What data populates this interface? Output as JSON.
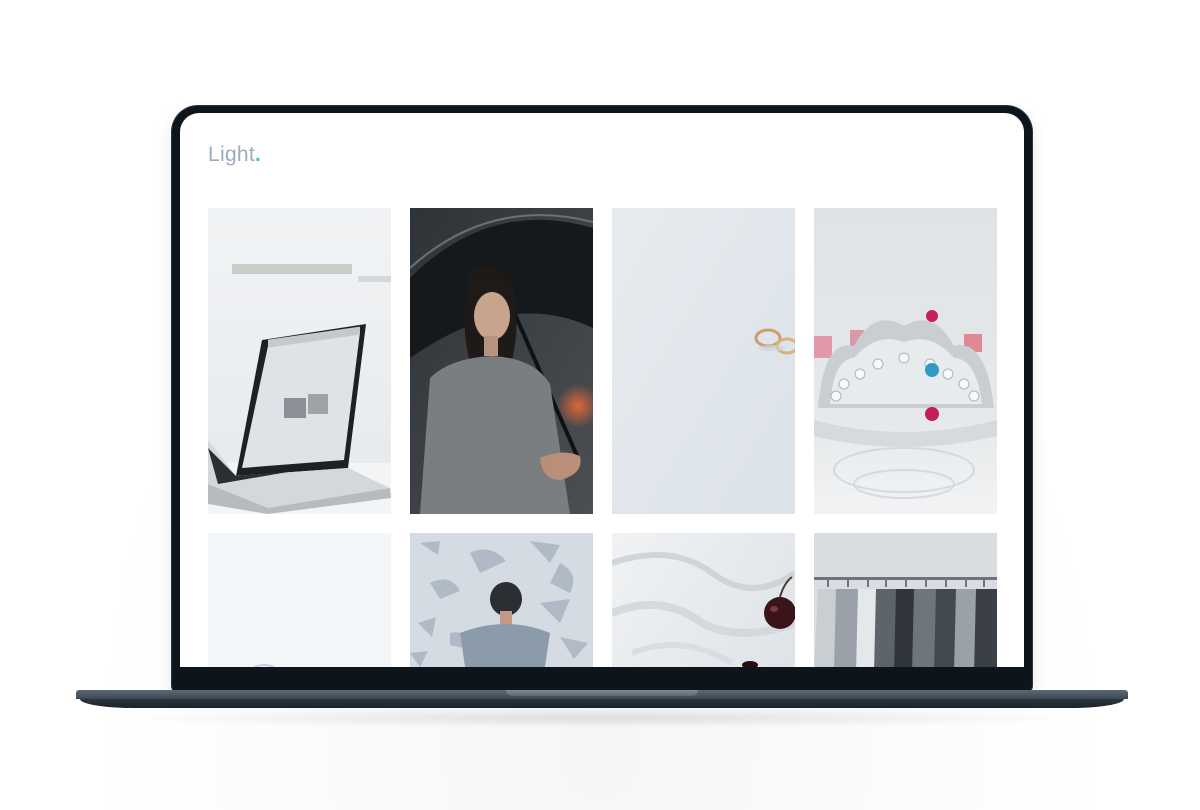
{
  "site": {
    "logo_text": "Light",
    "logo_dot": "."
  },
  "gallery": {
    "items": [
      {
        "subject": "laptop-on-desk"
      },
      {
        "subject": "woman-with-umbrella"
      },
      {
        "subject": "gold-rings"
      },
      {
        "subject": "jeweled-tiara"
      },
      {
        "subject": "white-paper-desk"
      },
      {
        "subject": "man-by-patterned-wall"
      },
      {
        "subject": "white-fabric-with-cherry"
      },
      {
        "subject": "clothes-rack"
      }
    ]
  },
  "colors": {
    "logo": "#9aacbe",
    "accent_dot": "#43c6b4",
    "bezel": "#0d141c",
    "screen_bg": "#ffffff"
  }
}
